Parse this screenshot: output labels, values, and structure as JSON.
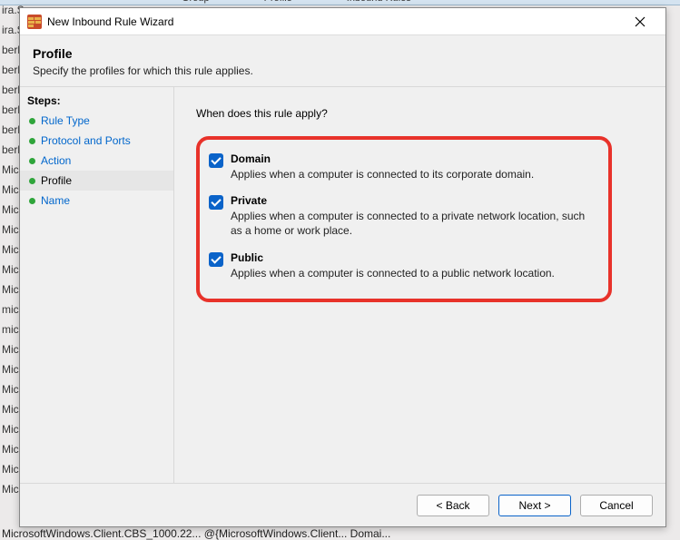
{
  "bg": {
    "top_cols": [
      "Group",
      "Profile",
      "Inbound Rules"
    ],
    "rows": [
      "ira.S",
      "ira.S",
      "berl",
      "berl",
      "berl",
      "berl",
      "berl",
      "berl",
      "Mic",
      "Mic",
      "Mic",
      "Mic",
      "Mic",
      "Mic",
      "Mic",
      "mic",
      "mic",
      "Mic",
      "Mic",
      "Mic",
      "Mic",
      "Mic",
      "Mic",
      "Mic",
      "Mic"
    ],
    "bottom": "MicrosoftWindows.Client.CBS_1000.22...    @{MicrosoftWindows.Client...    Domai..."
  },
  "dialog": {
    "title": "New Inbound Rule Wizard",
    "header_title": "Profile",
    "header_subtitle": "Specify the profiles for which this rule applies.",
    "steps_title": "Steps:",
    "steps": [
      {
        "label": "Rule Type",
        "state": "completed"
      },
      {
        "label": "Protocol and Ports",
        "state": "completed"
      },
      {
        "label": "Action",
        "state": "completed"
      },
      {
        "label": "Profile",
        "state": "current"
      },
      {
        "label": "Name",
        "state": "upcoming"
      }
    ],
    "prompt": "When does this rule apply?",
    "options": [
      {
        "title": "Domain",
        "desc": "Applies when a computer is connected to its corporate domain.",
        "checked": true
      },
      {
        "title": "Private",
        "desc": "Applies when a computer is connected to a private network location, such as a home or work place.",
        "checked": true
      },
      {
        "title": "Public",
        "desc": "Applies when a computer is connected to a public network location.",
        "checked": true
      }
    ],
    "buttons": {
      "back": "< Back",
      "next": "Next >",
      "cancel": "Cancel"
    }
  }
}
